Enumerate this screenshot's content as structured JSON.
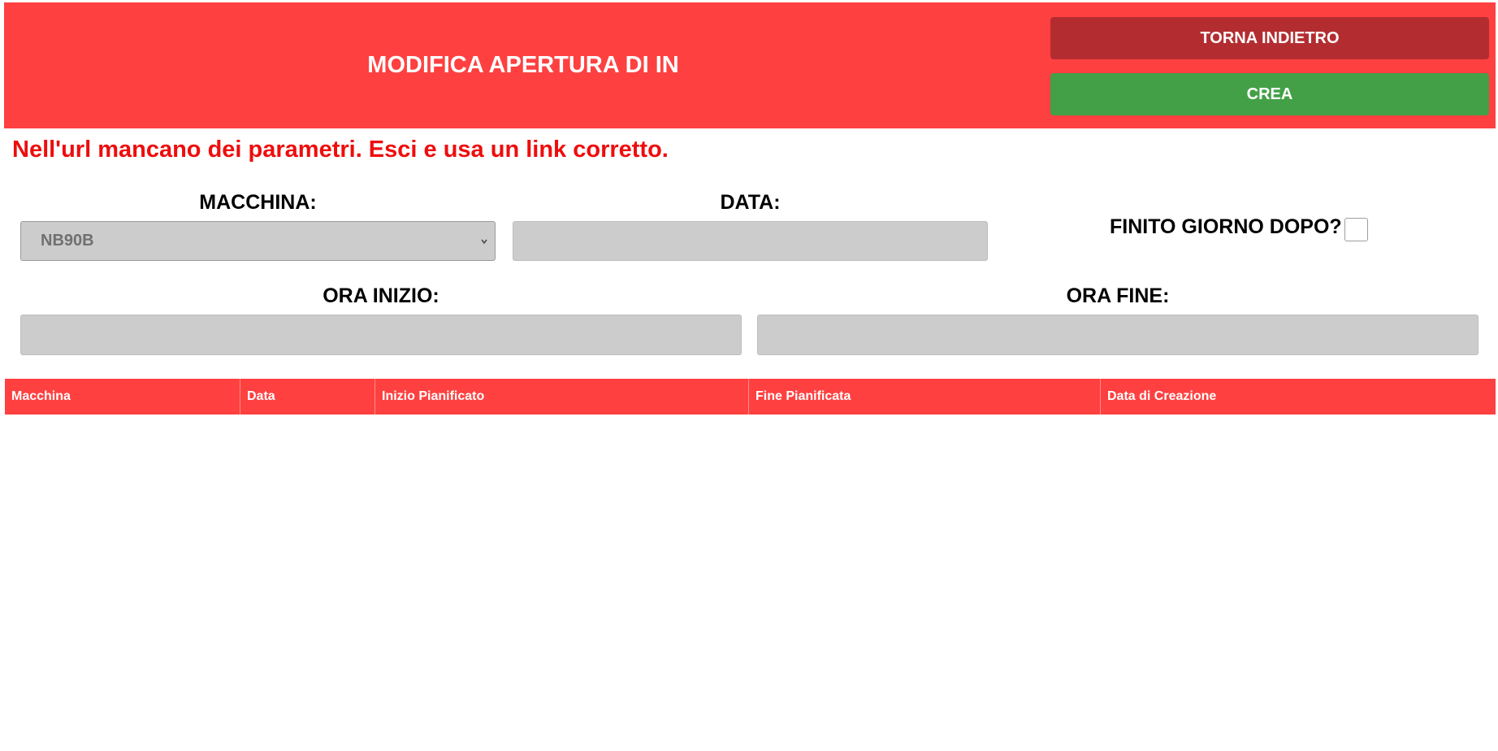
{
  "header": {
    "title": "MODIFICA APERTURA DI IN",
    "back_label": "TORNA INDIETRO",
    "create_label": "CREA"
  },
  "error_message": "Nell'url mancano dei parametri. Esci e usa un link corretto.",
  "form": {
    "machine": {
      "label": "MACCHINA:",
      "selected": "NB90B"
    },
    "date": {
      "label": "DATA:",
      "value": ""
    },
    "next_day": {
      "label": "FINITO GIORNO DOPO?",
      "checked": false
    },
    "start_time": {
      "label": "ORA INIZIO:",
      "value": ""
    },
    "end_time": {
      "label": "ORA FINE:",
      "value": ""
    }
  },
  "table": {
    "columns": [
      "Macchina",
      "Data",
      "Inizio Pianificato",
      "Fine Pianificata",
      "Data di Creazione"
    ],
    "rows": []
  },
  "colors": {
    "header_bg": "#ff4040",
    "back_button": "#b32d30",
    "create_button": "#43a047",
    "error_text": "#ee0d0d",
    "input_bg": "#cccccc"
  }
}
